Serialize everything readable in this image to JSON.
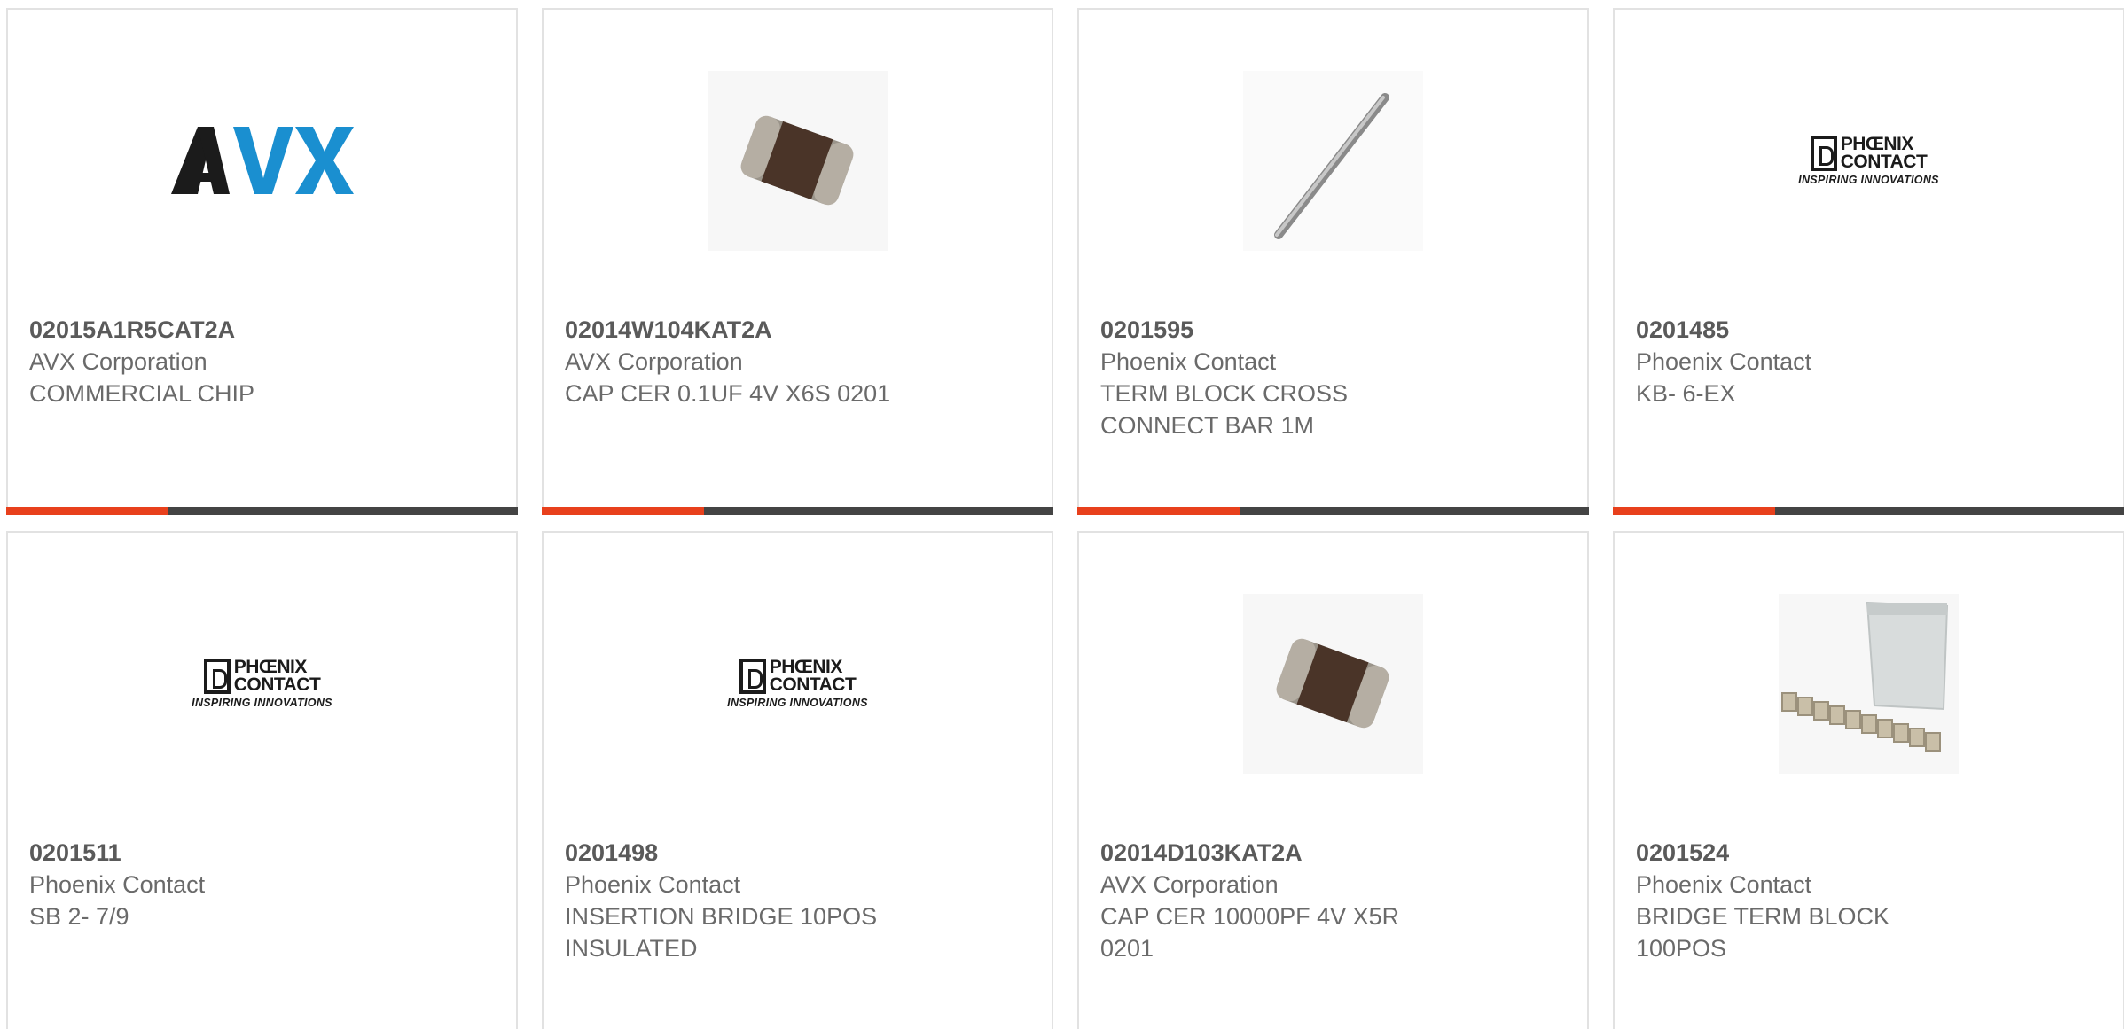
{
  "products": [
    {
      "part_number": "02015A1R5CAT2A",
      "manufacturer": "AVX Corporation",
      "description": "COMMERCIAL CHIP",
      "image": "avx-logo"
    },
    {
      "part_number": "02014W104KAT2A",
      "manufacturer": "AVX Corporation",
      "description": "CAP CER 0.1UF 4V X6S 0201",
      "image": "chip-capacitor-photo"
    },
    {
      "part_number": "0201595",
      "manufacturer": "Phoenix Contact",
      "description": "TERM BLOCK CROSS CONNECT BAR 1M",
      "image": "cross-connect-bar-photo"
    },
    {
      "part_number": "0201485",
      "manufacturer": "Phoenix Contact",
      "description": "KB- 6-EX",
      "image": "phoenix-contact-logo"
    },
    {
      "part_number": "0201511",
      "manufacturer": "Phoenix Contact",
      "description": "SB 2- 7/9",
      "image": "phoenix-contact-logo"
    },
    {
      "part_number": "0201498",
      "manufacturer": "Phoenix Contact",
      "description": "INSERTION BRIDGE 10POS INSULATED",
      "image": "phoenix-contact-logo"
    },
    {
      "part_number": "02014D103KAT2A",
      "manufacturer": "AVX Corporation",
      "description": "CAP CER 10000PF 4V X5R 0201",
      "image": "chip-capacitor-photo"
    },
    {
      "part_number": "0201524",
      "manufacturer": "Phoenix Contact",
      "description": "BRIDGE TERM BLOCK 100POS",
      "image": "bridge-term-block-photo"
    }
  ],
  "logos": {
    "avx": "AVX",
    "phoenix_line1": "PHŒNIX",
    "phoenix_line2": "CONTACT",
    "phoenix_tagline": "INSPIRING INNOVATIONS"
  },
  "colors": {
    "accent": "#e8401c",
    "bar": "#444444",
    "avx_blue": "#1a8fd0",
    "text": "#6a6a6a"
  }
}
